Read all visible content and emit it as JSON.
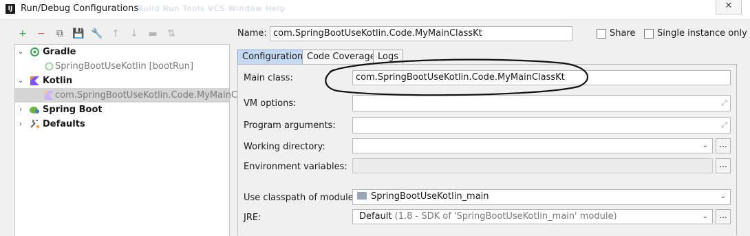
{
  "window": {
    "title": "Run/Debug Configurations",
    "ghost_menu": "Build   Run   Tools   VCS   Window   Help",
    "close_glyph": "✕"
  },
  "toolbar": {
    "buttons": [
      {
        "name": "add-icon",
        "glyph": "+",
        "color": "#2ea043"
      },
      {
        "name": "remove-icon",
        "glyph": "−",
        "color": "#d9534f"
      },
      {
        "name": "copy-icon",
        "glyph": "⧉",
        "color": "#555555"
      },
      {
        "name": "save-icon",
        "glyph": "💾",
        "color": "#555555"
      },
      {
        "name": "wrench-icon",
        "glyph": "🔧",
        "color": "#555555"
      },
      {
        "name": "move-up-icon",
        "glyph": "↑",
        "color": "#b5b5b5"
      },
      {
        "name": "move-down-icon",
        "glyph": "↓",
        "color": "#b5b5b5"
      },
      {
        "name": "folder-icon",
        "glyph": "▬",
        "color": "#b5b5b5"
      },
      {
        "name": "sort-icon",
        "glyph": "⇅",
        "color": "#b5b5b5"
      }
    ]
  },
  "tree": {
    "gradle": "Gradle",
    "gradle_child": "SpringBootUseKotlin [bootRun]",
    "kotlin": "Kotlin",
    "kotlin_child": "com.SpringBootUseKotlin.Code.MyMainCla",
    "spring_boot": "Spring Boot",
    "defaults": "Defaults"
  },
  "name_field": {
    "label": "Name:",
    "value": "com.SpringBootUseKotlin.Code.MyMainClassKt"
  },
  "share": {
    "label": "Share",
    "checked": false
  },
  "single_instance": {
    "label": "Single instance only",
    "checked": false
  },
  "tabs": [
    "Configuration",
    "Code Coverage",
    "Logs"
  ],
  "form": {
    "main_class": {
      "label": "Main class:",
      "value": "com.SpringBootUseKotlin.Code.MyMainClassKt"
    },
    "vm_options": {
      "label": "VM options:",
      "value": ""
    },
    "program_arguments": {
      "label": "Program arguments:",
      "value": ""
    },
    "working_directory": {
      "label": "Working directory:",
      "value": ""
    },
    "environment_variables": {
      "label": "Environment variables:",
      "value": ""
    },
    "classpath_module": {
      "label": "Use classpath of module:",
      "value": "SpringBootUseKotlin_main"
    },
    "jre": {
      "label": "JRE:",
      "value_main": "Default",
      "value_detail": "(1.8 - SDK of 'SpringBootUseKotlin_main' module)"
    },
    "browse_label": "..."
  },
  "colors": {
    "selection": "#d5d5d5",
    "active_tab": "#c6d9f2",
    "gradle_green": "#3fa155",
    "kotlin_orange": "#f18e33",
    "kotlin_purple": "#7f52ff",
    "spring_green": "#6db33f"
  }
}
